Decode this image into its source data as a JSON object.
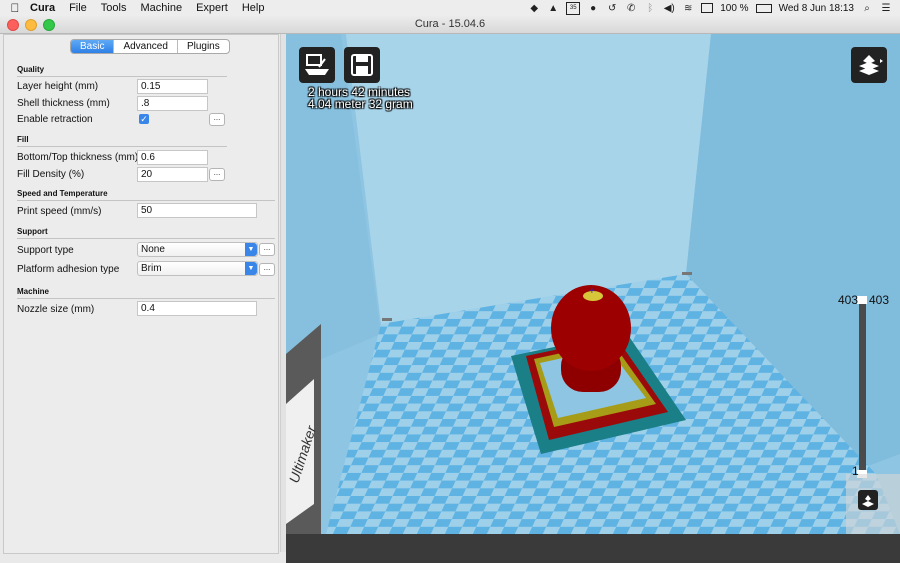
{
  "menubar": {
    "apple": "",
    "items": [
      "Cura",
      "File",
      "Tools",
      "Machine",
      "Expert",
      "Help"
    ],
    "battery": "100 %",
    "datetime": "Wed 8 Jun  18:13"
  },
  "window": {
    "title": "Cura - 15.04.6"
  },
  "tabs": [
    "Basic",
    "Advanced",
    "Plugins"
  ],
  "settings": {
    "quality": {
      "heading": "Quality",
      "layer_height_label": "Layer height (mm)",
      "layer_height": "0.15",
      "shell_thickness_label": "Shell thickness (mm)",
      "shell_thickness": ".8",
      "retraction_label": "Enable retraction",
      "retraction_checked": "✓"
    },
    "fill": {
      "heading": "Fill",
      "bottom_top_label": "Bottom/Top thickness (mm)",
      "bottom_top": "0.6",
      "density_label": "Fill Density (%)",
      "density": "20"
    },
    "speed": {
      "heading": "Speed and Temperature",
      "print_speed_label": "Print speed (mm/s)",
      "print_speed": "50"
    },
    "support": {
      "heading": "Support",
      "support_type_label": "Support type",
      "support_type": "None",
      "adhesion_label": "Platform adhesion type",
      "adhesion": "Brim"
    },
    "machine": {
      "heading": "Machine",
      "nozzle_label": "Nozzle size (mm)",
      "nozzle": "0.4"
    },
    "more_button": "..."
  },
  "viewport": {
    "print_time": "2 hours 42 minutes",
    "material": "4.04 meter 32 gram",
    "layer_max_left": "403",
    "layer_max_right": "403",
    "layer_min": "1",
    "machine_label": "Ultimaker"
  },
  "colors": {
    "accent": "#3a86e8",
    "sky": "#8ec5e2",
    "grid_a": "#5fb3e3",
    "grid_b": "#9fd0ea",
    "model": "#8e0000",
    "brim": "#1a7f86"
  }
}
